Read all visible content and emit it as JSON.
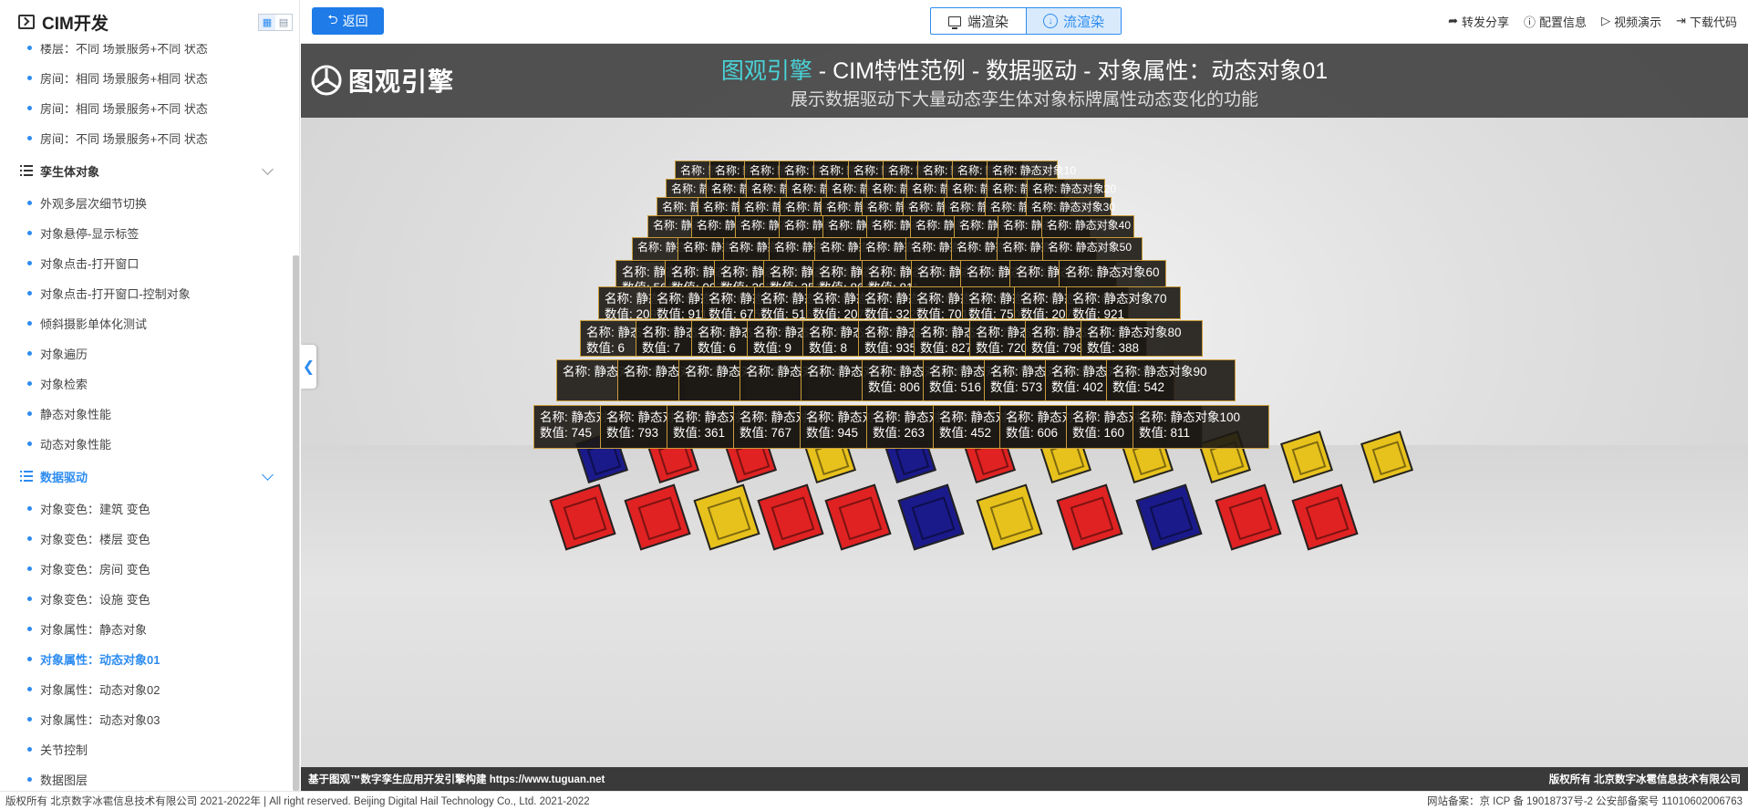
{
  "sidebar": {
    "title": "CIM开发",
    "view_toggle": [
      "▦",
      "▤"
    ],
    "entries": [
      {
        "kind": "item",
        "label": "楼层：不同 场景服务+不同 状态"
      },
      {
        "kind": "item",
        "label": "房间：相同 场景服务+相同 状态"
      },
      {
        "kind": "item",
        "label": "房间：相同 场景服务+不同 状态"
      },
      {
        "kind": "item",
        "label": "房间：不同 场景服务+不同 状态"
      },
      {
        "kind": "group",
        "label": "孪生体对象",
        "open": false
      },
      {
        "kind": "item",
        "label": "外观多层次细节切换"
      },
      {
        "kind": "item",
        "label": "对象悬停-显示标签"
      },
      {
        "kind": "item",
        "label": "对象点击-打开窗口"
      },
      {
        "kind": "item",
        "label": "对象点击-打开窗口-控制对象"
      },
      {
        "kind": "item",
        "label": "倾斜摄影单体化测试"
      },
      {
        "kind": "item",
        "label": "对象遍历"
      },
      {
        "kind": "item",
        "label": "对象检索"
      },
      {
        "kind": "item",
        "label": "静态对象性能"
      },
      {
        "kind": "item",
        "label": "动态对象性能"
      },
      {
        "kind": "group",
        "label": "数据驱动",
        "open": true
      },
      {
        "kind": "item",
        "label": "对象变色：建筑 变色"
      },
      {
        "kind": "item",
        "label": "对象变色：楼层 变色"
      },
      {
        "kind": "item",
        "label": "对象变色：房间 变色"
      },
      {
        "kind": "item",
        "label": "对象变色：设施 变色"
      },
      {
        "kind": "item",
        "label": "对象属性：静态对象"
      },
      {
        "kind": "item",
        "label": "对象属性：动态对象01",
        "active": true
      },
      {
        "kind": "item",
        "label": "对象属性：动态对象02"
      },
      {
        "kind": "item",
        "label": "对象属性：动态对象03"
      },
      {
        "kind": "item",
        "label": "关节控制"
      },
      {
        "kind": "item",
        "label": "数据图层"
      }
    ]
  },
  "toolbar": {
    "back_label": "返回",
    "render_client": "端渲染",
    "render_stream": "流渲染",
    "links": [
      {
        "icon": "share-icon",
        "glyph": "➦",
        "label": "转发分享"
      },
      {
        "icon": "info-icon",
        "glyph": "ⓘ",
        "label": "配置信息"
      },
      {
        "icon": "play-icon",
        "glyph": "▷",
        "label": "视频演示"
      },
      {
        "icon": "download-icon",
        "glyph": "⇥",
        "label": "下载代码"
      }
    ]
  },
  "banner": {
    "logo_text": "图观引擎",
    "title_highlight": "图观引擎",
    "title_rest": " - CIM特性范例 - 数据驱动 - 对象属性：动态对象01",
    "subtitle": "展示数据驱动下大量动态孪生体对象标牌属性动态变化的功能"
  },
  "labels": {
    "name_prefix": "名称:",
    "value_prefix": "数值:",
    "object_prefix": "静态对象",
    "visible_values": {
      "56": "811",
      "66": "322",
      "67": "701",
      "68": "750",
      "69": "207",
      "70": "921",
      "76": "935",
      "77": "827",
      "78": "720",
      "79": "798",
      "80": "388",
      "86": "806",
      "87": "516",
      "88": "573",
      "89": "402",
      "90": "542",
      "91": "745",
      "92": "793",
      "93": "361",
      "94": "767",
      "95": "945",
      "96": "263",
      "97": "452",
      "98": "606",
      "99": "160",
      "100": "811",
      "51": "561",
      "52": "997",
      "53": "295",
      "54": "251",
      "55": "864",
      "61": "209",
      "62": "911",
      "63": "675",
      "64": "516",
      "65": "207",
      "71": "6",
      "72": "7",
      "73": "6",
      "74": "9",
      "75": "8"
    }
  },
  "viewport_footer": {
    "left": "基于图观™数字孪生应用开发引擎构建 https://www.tuguan.net",
    "right": "版权所有 北京数字冰雹信息技术有限公司"
  },
  "footer": {
    "left": "版权所有 北京数字冰雹信息技术有限公司 2021-2022年 | All right reserved. Beijing Digital Hail Technology Co., Ltd. 2021-2022",
    "right": "网站备案：京 ICP 备 19018737号-2 公安部备案号 11010602006763"
  },
  "colors": {
    "accent": "#2d8cf0",
    "label_border": "#c99c3a",
    "cube_red": "#e02222",
    "cube_yellow": "#e8c21c",
    "cube_blue": "#1a1a8a",
    "title_highlight": "#4ad3d8"
  }
}
